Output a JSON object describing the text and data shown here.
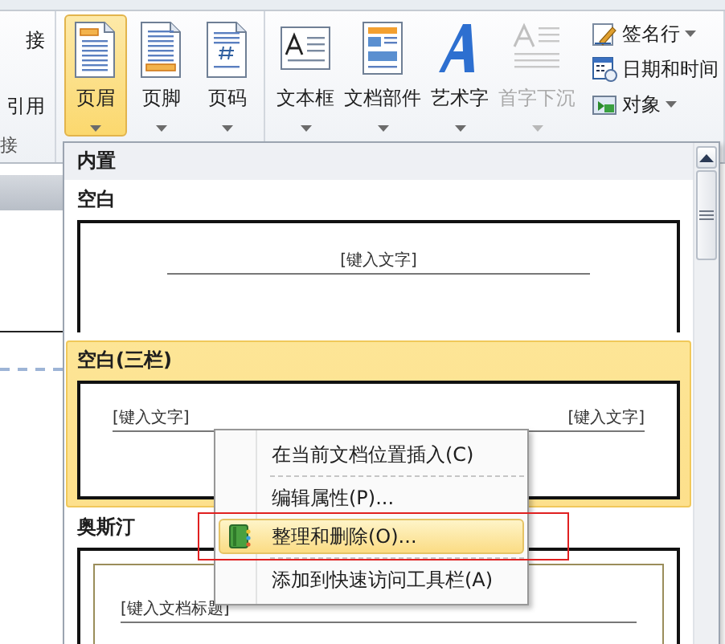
{
  "left_fragment": {
    "items": [
      "接",
      "引用"
    ],
    "group_label": "接"
  },
  "ribbon": {
    "groups": [
      {
        "buttons": [
          {
            "label": "页眉",
            "kind": "header",
            "selected": true,
            "disabled": false
          },
          {
            "label": "页脚",
            "kind": "footer",
            "selected": false,
            "disabled": false
          },
          {
            "label": "页码",
            "kind": "pagenumber",
            "selected": false,
            "disabled": false
          }
        ]
      },
      {
        "buttons": [
          {
            "label": "文本框",
            "kind": "textbox",
            "selected": false,
            "disabled": false
          },
          {
            "label": "文档部件",
            "kind": "quickparts",
            "selected": false,
            "disabled": false
          },
          {
            "label": "艺术字",
            "kind": "wordart",
            "selected": false,
            "disabled": false
          },
          {
            "label": "首字下沉",
            "kind": "dropcap",
            "selected": false,
            "disabled": true
          }
        ],
        "small_buttons": [
          {
            "label": "签名行",
            "kind": "signature",
            "dropdown": true
          },
          {
            "label": "日期和时间",
            "kind": "datetime",
            "dropdown": false
          },
          {
            "label": "对象",
            "kind": "object",
            "dropdown": true
          }
        ]
      }
    ]
  },
  "gallery": {
    "section": "内置",
    "items": [
      {
        "title": "空白",
        "kind": "center",
        "selected": false,
        "preview_texts": [
          "[键入文字]"
        ]
      },
      {
        "title": "空白(三栏)",
        "kind": "three",
        "selected": true,
        "preview_texts": [
          "[键入文字]",
          "[键入文字]"
        ]
      },
      {
        "title": "奥斯汀",
        "kind": "framed",
        "selected": false,
        "preview_texts": [
          "[键入文档标题]"
        ]
      }
    ]
  },
  "context_menu": [
    {
      "kind": "item",
      "label": "在当前文档位置插入(C)",
      "selected": false,
      "icon": false
    },
    {
      "kind": "separator"
    },
    {
      "kind": "item",
      "label": "编辑属性(P)...",
      "selected": false,
      "icon": false
    },
    {
      "kind": "item",
      "label": "整理和删除(O)...",
      "selected": true,
      "icon": true
    },
    {
      "kind": "separator"
    },
    {
      "kind": "item",
      "label": "添加到快速访问工具栏(A)",
      "selected": false,
      "icon": false
    }
  ]
}
